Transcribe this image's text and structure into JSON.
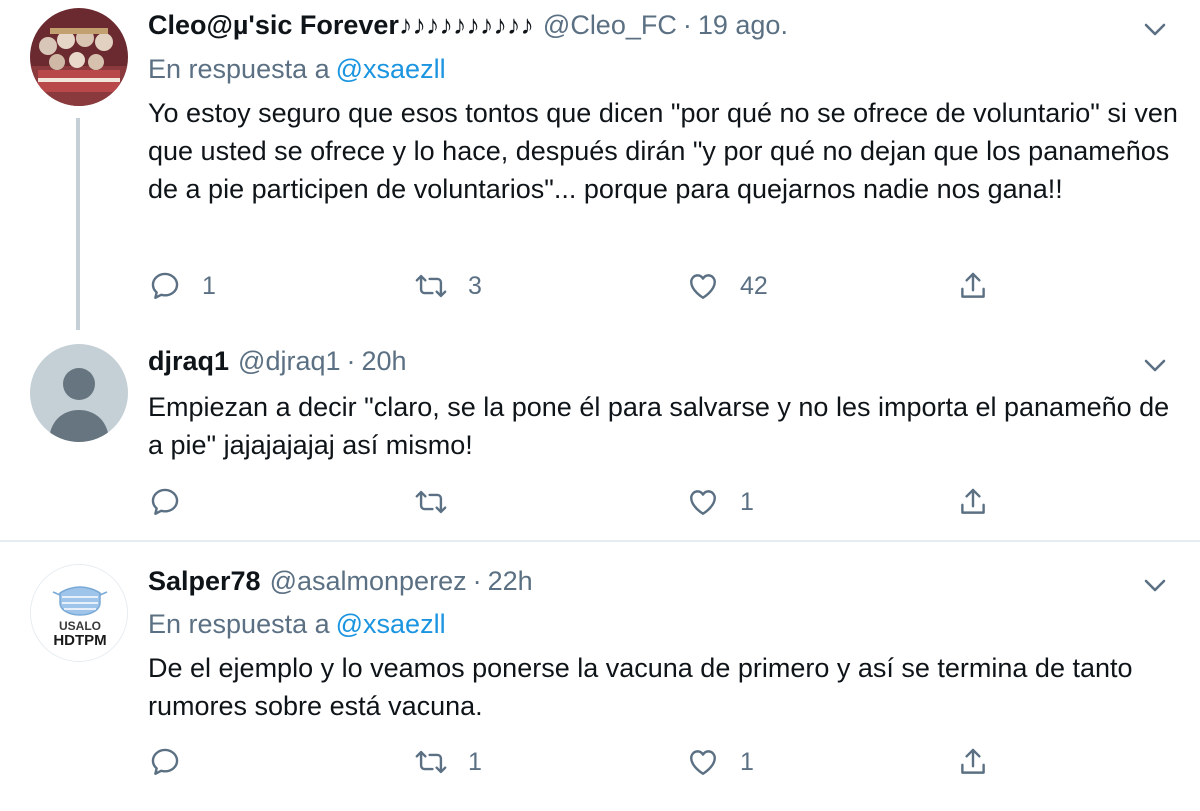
{
  "tweets": [
    {
      "name": "Cleo@µ'sic Forever♪♪♪♪♪♪♪♪♪♪",
      "handle": "@Cleo_FC",
      "dot": "·",
      "time": "19 ago.",
      "reply_label": "En respuesta a",
      "reply_mention": "@xsaezll",
      "text": "Yo estoy seguro que esos tontos que dicen \"por qué no se ofrece de voluntario\" si ven que usted se ofrece y lo hace, después dirán \"y por qué no dejan que los panameños de a pie participen de voluntarios\"... porque para quejarnos nadie nos gana!!",
      "replies": "1",
      "retweets": "3",
      "likes": "42"
    },
    {
      "name": "djraq1",
      "handle": "@djraq1",
      "dot": "·",
      "time": "20h",
      "text": "Empiezan a decir \"claro, se la pone él para salvarse y no les importa el panameño de a pie\" jajajajajaj así mismo!",
      "replies": "",
      "retweets": "",
      "likes": "1"
    },
    {
      "name": "Salper78",
      "handle": "@asalmonperez",
      "dot": "·",
      "time": "22h",
      "reply_label": "En respuesta a",
      "reply_mention": "@xsaezll",
      "text": "De el ejemplo y lo veamos ponerse la vacuna de primero y así se termina de tanto rumores sobre está vacuna.",
      "replies": "",
      "retweets": "1",
      "likes": "1",
      "avatar_text_top": "USALO",
      "avatar_text_bottom": "HDTPM"
    }
  ],
  "colors": {
    "text": "#0f1419",
    "secondary": "#5b7083",
    "link": "#1b95e0",
    "thread_line": "#c4cfd6",
    "divider": "#e6ecf0"
  },
  "icons": [
    "chevron-down-icon",
    "reply-icon",
    "retweet-icon",
    "like-icon",
    "share-icon",
    "default-avatar-icon",
    "mask-icon"
  ]
}
